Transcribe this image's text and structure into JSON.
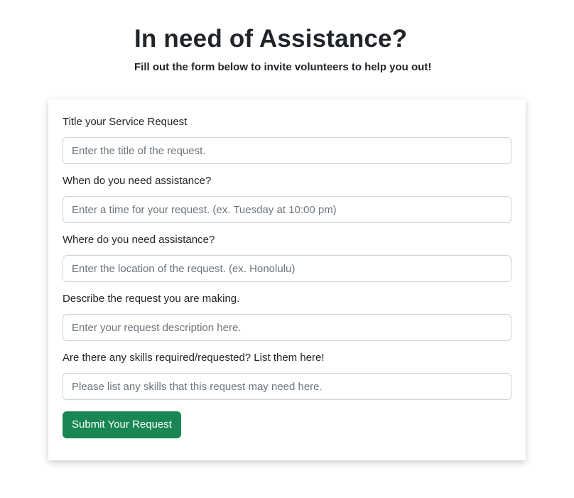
{
  "header": {
    "title": "In need of Assistance?",
    "subtitle": "Fill out the form below to invite volunteers to help you out!"
  },
  "form": {
    "fields": [
      {
        "label": "Title your Service Request",
        "value": "",
        "placeholder": "Enter the title of the request."
      },
      {
        "label": "When do you need assistance?",
        "value": "",
        "placeholder": "Enter a time for your request. (ex. Tuesday at 10:00 pm)"
      },
      {
        "label": "Where do you need assistance?",
        "value": "",
        "placeholder": "Enter the location of the request. (ex. Honolulu)"
      },
      {
        "label": "Describe the request you are making.",
        "value": "",
        "placeholder": "Enter your request description here."
      },
      {
        "label": "Are there any skills required/requested? List them here!",
        "value": "",
        "placeholder": "Please list any skills that this request may need here."
      }
    ],
    "submit_label": "Submit Your Request"
  },
  "colors": {
    "text": "#212529",
    "placeholder": "#6c757d",
    "input_border": "#ced4da",
    "submit_button": "#198754",
    "submit_text": "#ffffff",
    "background": "#ffffff"
  }
}
